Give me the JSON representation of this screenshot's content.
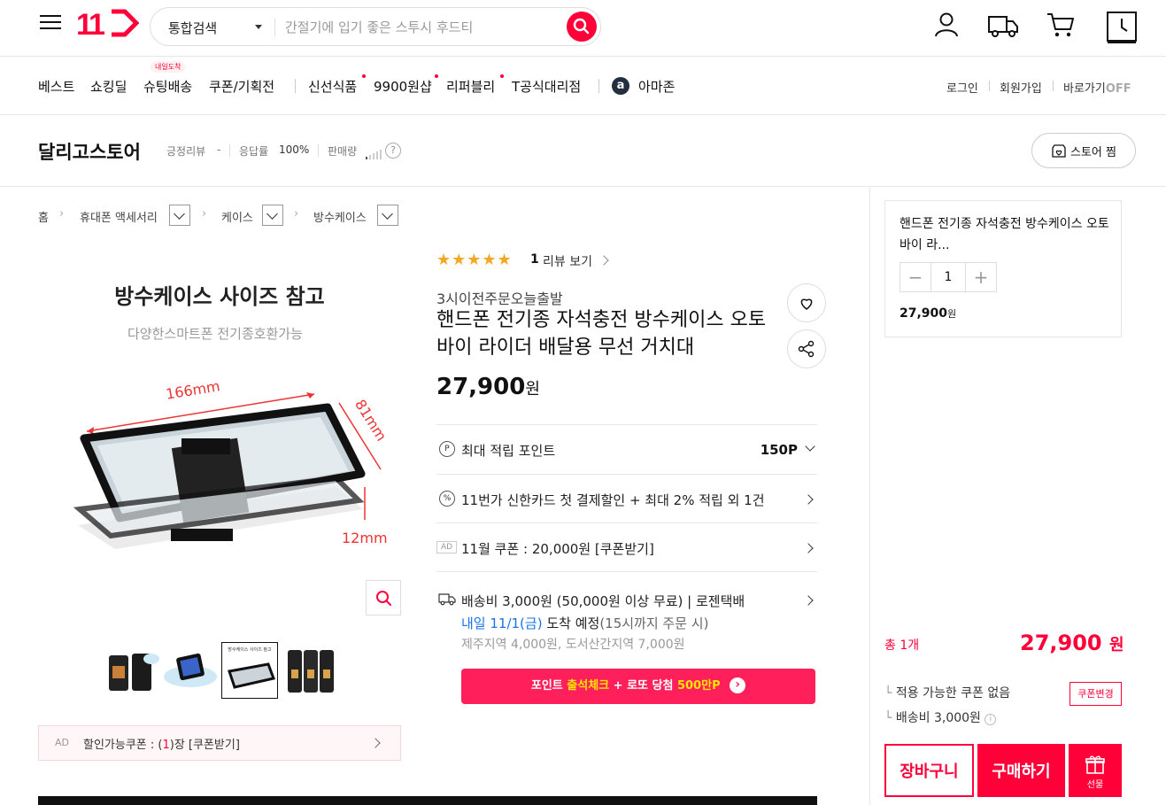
{
  "header": {
    "logo": "11",
    "search_category": "통합검색",
    "search_placeholder": "간절기에 입기 좋은 스투시 후드티"
  },
  "nav": {
    "items": [
      "베스트",
      "쇼킹딜",
      "슈팅배송",
      "쿠폰/기획전",
      "신선식품",
      "9900원샵",
      "리퍼블리",
      "T공식대리점",
      "아마존"
    ],
    "badge": "내일도착",
    "amazon_logo": "a",
    "util": {
      "login": "로그인",
      "signup": "회원가입",
      "shortcut": "바로가기",
      "off": "OFF"
    }
  },
  "store": {
    "name": "달리고스토어",
    "positive_review_label": "긍정리뷰",
    "positive_review_value": "-",
    "response_label": "응답률",
    "response_value": "100%",
    "sales_label": "판매량",
    "help": "?",
    "wish_button": "스토어 찜"
  },
  "breadcrumb": [
    "홈",
    "휴대폰 액세서리",
    "케이스",
    "방수케이스"
  ],
  "gallery": {
    "image_title": "방수케이스 사이즈 참고",
    "image_subtitle": "다양한스마트폰 전기종호환가능",
    "dim_length": "166mm",
    "dim_width": "81mm",
    "dim_depth": "12mm",
    "thumb_title": "방수케이스 사이즈 참고",
    "selected_thumb": 3
  },
  "coupon_bar": {
    "ad": "AD",
    "text_a": "할인가능쿠폰 : (",
    "count": "1",
    "text_b": ")장 [쿠폰받기]"
  },
  "product": {
    "stars": "★★★★★",
    "review_count": "1",
    "review_link": "리뷰 보기",
    "delivery_badge": "3시이전주문오늘출발",
    "title": "핸드폰 전기종 자석충전 방수케이스 오토바이 라이더 배달용 무선 거치대",
    "price": "27,900",
    "price_unit": "원"
  },
  "benefits": {
    "point_icon": "P",
    "point_label": "최대 적립 포인트",
    "point_value": "150P",
    "card_icon": "%",
    "card_text": "11번가 신한카드 첫 결제할인 + 최대 2% 적립 외 1건",
    "coupon_ad": "AD",
    "coupon_text": "11월 쿠폰 : 20,000원 [쿠폰받기]",
    "shipping_text": "배송비 3,000원 (50,000원 이상 무료) | 로젠택배",
    "arrival_highlight": "내일 11/1(금)",
    "arrival_rest": " 도착 예정",
    "arrival_note": "(15시까지 주문 시)",
    "extra_fee": "제주지역 4,000원, 도서산간지역 7,000원"
  },
  "promo": {
    "a": "포인트 ",
    "b": "출석체크",
    "c": " + 로또 당첨 ",
    "d": "500만P",
    "arrow": "›"
  },
  "side": {
    "option_name": "핸드폰 전기종 자석충전 방수케이스 오토바이 라...",
    "minus": "−",
    "quantity": "1",
    "plus": "+",
    "option_price": "27,900",
    "unit": "원",
    "total_label": "총 1개",
    "total_price": "27,900",
    "total_unit": "원",
    "coupon_line": "적용 가능한 쿠폰 없음",
    "coupon_change": "쿠폰변경",
    "shipping_line": "배송비 3,000원",
    "info": "i",
    "cart": "장바구니",
    "buy": "구매하기",
    "gift": "선물"
  },
  "colors": {
    "accent": "#ff0038",
    "promo": "#ff1f5a",
    "star": "#f5a623",
    "link": "#1a73e8"
  }
}
